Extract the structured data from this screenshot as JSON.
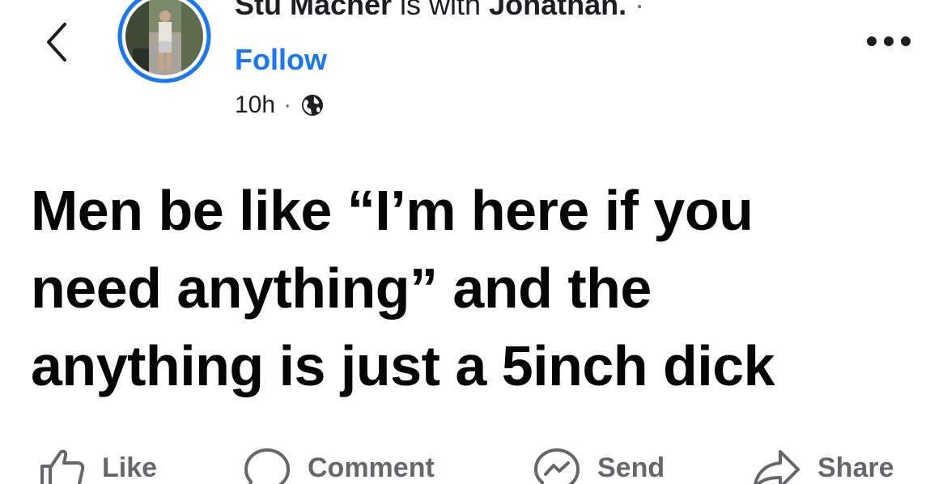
{
  "header": {
    "author_name": "Stu Macher",
    "with_text": " is with ",
    "tagged_name": "Jonathan.",
    "separator": " ·",
    "follow_label": "Follow",
    "timestamp": "10h",
    "meta_separator": "·",
    "audience_icon": "globe-icon",
    "back_icon": "chevron-left-icon",
    "more_icon": "more-horizontal-icon"
  },
  "post": {
    "lines": [
      "Men be like “I’m here if you",
      "need anything” and the",
      "anything is just a 5inch dick"
    ]
  },
  "actions": {
    "like_label": "Like",
    "comment_label": "Comment",
    "send_label": "Send",
    "share_label": "Share"
  },
  "colors": {
    "accent": "#1877f2",
    "text": "#050505",
    "secondary": "#65676b",
    "background": "#ffffff"
  }
}
